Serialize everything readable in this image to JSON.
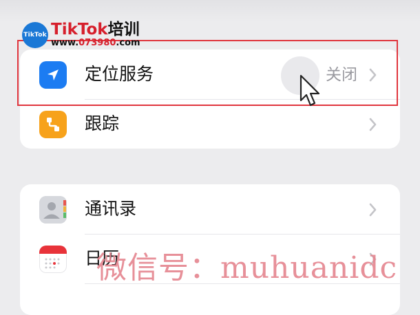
{
  "watermark_brand": {
    "badge": "TikTok",
    "name_latin": "TikTok",
    "name_cn": "培训",
    "url_prefix": "www.",
    "url_number": "073980",
    "url_suffix": ".com"
  },
  "privacy_group": {
    "items": [
      {
        "label": "定位服务",
        "value": "关闭",
        "icon": "location-arrow-icon",
        "icon_color": "#1c7cf2"
      },
      {
        "label": "跟踪",
        "value": "",
        "icon": "tracking-icon",
        "icon_color": "#f7a21b"
      }
    ]
  },
  "apps_group": {
    "items": [
      {
        "label": "通讯录",
        "value": "",
        "icon": "contacts-icon",
        "icon_color": "#d3d5da"
      },
      {
        "label": "日历",
        "value": "",
        "icon": "calendar-icon",
        "icon_color": "#e8333a"
      }
    ]
  },
  "watermark_text": "微信号：muhuanidc",
  "colors": {
    "highlight": "#e0353d",
    "background": "#ececee",
    "value_text": "#9a9aa0"
  }
}
